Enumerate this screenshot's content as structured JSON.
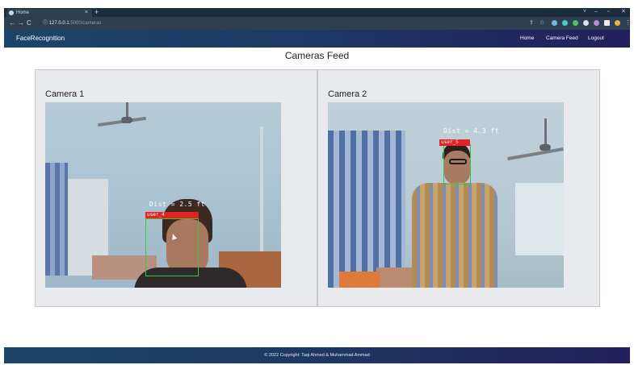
{
  "browser": {
    "tab_title": "Home",
    "tab_close": "×",
    "new_tab": "+",
    "url_host": "127.0.0.1",
    "url_path": ":5000/cameras",
    "window_controls": [
      "˅",
      "–",
      "▫",
      "✕"
    ]
  },
  "navbar": {
    "brand": "FaceRecognition",
    "links": [
      "Home",
      "Camera Feed",
      "Logout"
    ]
  },
  "page": {
    "title": "Cameras Feed"
  },
  "cameras": [
    {
      "title": "Camera 1",
      "distance_text": "Dist = 2.5 ft",
      "user_label": "user_4"
    },
    {
      "title": "Camera 2",
      "distance_text": "Dist = 4.3 ft",
      "user_label": "user_5"
    }
  ],
  "footer": {
    "text": "© 2022 Copyright: Taqi Ahmed & Muhammad Ammad"
  },
  "colors": {
    "navbar_start": "#1b4568",
    "navbar_end": "#221f5c",
    "label_red": "#e52222",
    "box_green": "#39c83a"
  }
}
